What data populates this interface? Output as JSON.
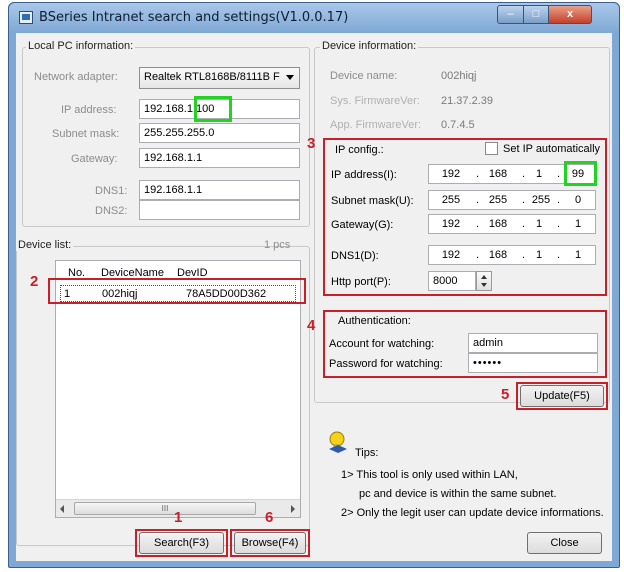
{
  "window": {
    "title": "BSeries Intranet search and settings(V1.0.0.17)",
    "min_glyph": "–",
    "max_glyph": "□",
    "close_glyph": "x"
  },
  "local_pc": {
    "group_title": "Local PC information:",
    "network_adapter_label": "Network adapter:",
    "network_adapter_value": "Realtek RTL8168B/8111B F",
    "ip_label": "IP address:",
    "ip_value": "192.168.1.100",
    "subnet_label": "Subnet mask:",
    "subnet_value": "255.255.255.0",
    "gateway_label": "Gateway:",
    "gateway_value": "192.168.1.1",
    "dns1_label": "DNS1:",
    "dns1_value": "192.168.1.1",
    "dns2_label": "DNS2:",
    "dns2_value": ""
  },
  "device_list": {
    "group_title": "Device list:",
    "count": "1 pcs",
    "columns": [
      "No.",
      "DeviceName",
      "DevID"
    ],
    "rows": [
      {
        "no": "1",
        "name": "002hiqj",
        "id": "78A5DD00D362"
      }
    ],
    "scroll_thumb": "III"
  },
  "device_info": {
    "group_title": "Device information:",
    "name_label": "Device name:",
    "name_value": "002hiqj",
    "fw_label": "Sys. FirmwareVer:",
    "fw_value": "21.37.2.39",
    "appfw_label": "App. FirmwareVer:",
    "appfw_value": "0.7.4.5"
  },
  "ip_config": {
    "group_title": "IP config.:",
    "auto_label": "Set IP automatically",
    "ip_label": "IP address(I):",
    "ip": [
      "192",
      "168",
      "1",
      "99"
    ],
    "subnet_label": "Subnet mask(U):",
    "subnet": [
      "255",
      "255",
      "255",
      "0"
    ],
    "gateway_label": "Gateway(G):",
    "gateway": [
      "192",
      "168",
      "1",
      "1"
    ],
    "dns1_label": "DNS1(D):",
    "dns1": [
      "192",
      "168",
      "1",
      "1"
    ],
    "http_label": "Http port(P):",
    "http_value": "8000"
  },
  "auth": {
    "group_title": "Authentication:",
    "account_label": "Account for watching:",
    "account_value": "admin",
    "password_label": "Password for watching:",
    "password_value": "••••••"
  },
  "buttons": {
    "update": "Update(F5)",
    "search": "Search(F3)",
    "browse": "Browse(F4)",
    "close": "Close"
  },
  "tips": {
    "title": "Tips:",
    "line1": "1> This tool is only used within LAN,",
    "line2": "pc and device is within the same subnet.",
    "line3": "2> Only the legit user can update  device informations."
  },
  "annotations": {
    "n1": "1",
    "n2": "2",
    "n3": "3",
    "n4": "4",
    "n5": "5",
    "n6": "6",
    "red_color": "#c8202a",
    "green_color": "#22d322"
  }
}
